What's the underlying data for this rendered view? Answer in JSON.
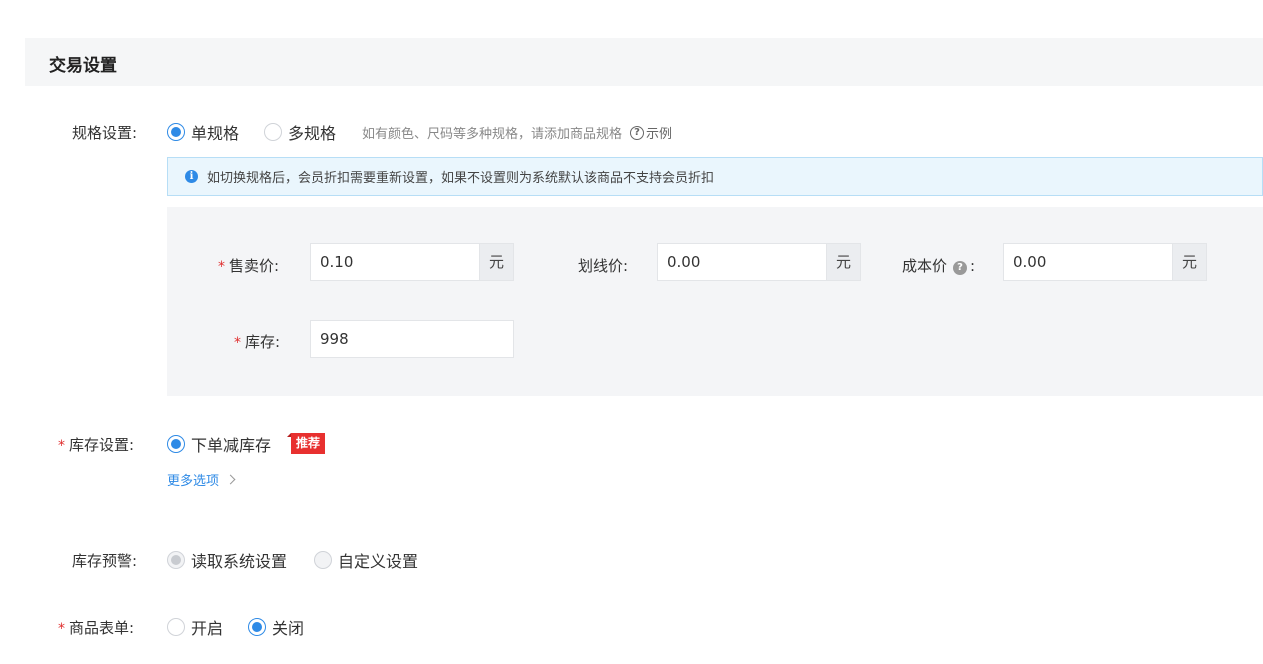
{
  "section": {
    "title": "交易设置"
  },
  "spec": {
    "label": "规格设置:",
    "options": [
      "单规格",
      "多规格"
    ],
    "selected": 0,
    "hint": "如有颜色、尺码等多种规格，请添加商品规格",
    "example": "示例"
  },
  "notice": {
    "text": "如切换规格后，会员折扣需要重新设置，如果不设置则为系统默认该商品不支持会员折扣"
  },
  "price": {
    "sale_label": "售卖价:",
    "sale_value": "0.10",
    "sale_suffix": "元",
    "strike_label": "划线价:",
    "strike_value": "0.00",
    "strike_suffix": "元",
    "cost_label": "成本价",
    "cost_colon": ":",
    "cost_value": "0.00",
    "cost_suffix": "元",
    "stock_label": "库存:",
    "stock_value": "998"
  },
  "stock_setting": {
    "label": "库存设置:",
    "option": "下单减库存",
    "tag": "推荐",
    "more": "更多选项"
  },
  "stock_warning": {
    "label": "库存预警:",
    "options": [
      "读取系统设置",
      "自定义设置"
    ],
    "selected": 0
  },
  "product_form": {
    "label": "商品表单:",
    "options": [
      "开启",
      "关闭"
    ],
    "selected": 1
  },
  "colors": {
    "accent": "#2e8ae6",
    "required": "#e02e2e",
    "tag": "#e8302f"
  }
}
